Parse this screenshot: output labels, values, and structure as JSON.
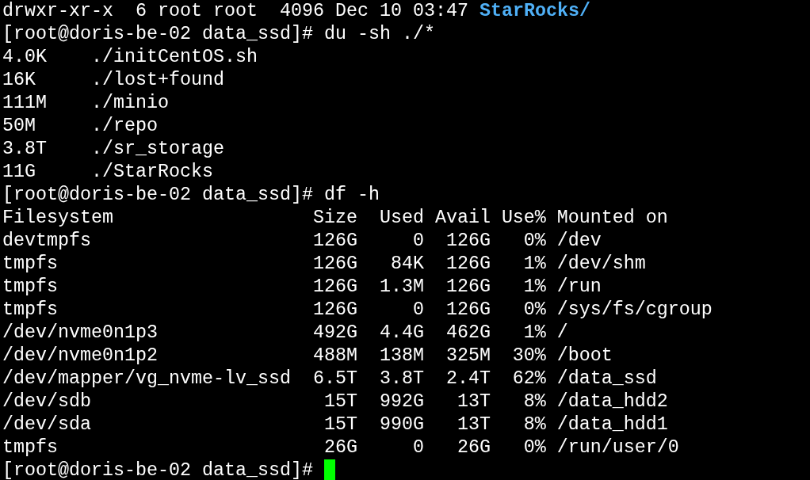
{
  "terminal": {
    "lines": [
      {
        "kind": "listing",
        "text": "drwxr-xr-x  6 root root  4096 Dec 10 03:47",
        "entry": "StarRocks/"
      },
      {
        "kind": "command",
        "prompt": "[root@doris-be-02 data_ssd]#",
        "command": "du -sh ./*",
        "cursor": false
      },
      {
        "kind": "du",
        "size": "4.0K",
        "path": "./initCentOS.sh"
      },
      {
        "kind": "du",
        "size": "16K",
        "path": "./lost+found"
      },
      {
        "kind": "du",
        "size": "111M",
        "path": "./minio"
      },
      {
        "kind": "du",
        "size": "50M",
        "path": "./repo"
      },
      {
        "kind": "du",
        "size": "3.8T",
        "path": "./sr_storage"
      },
      {
        "kind": "du",
        "size": "11G",
        "path": "./StarRocks"
      },
      {
        "kind": "command",
        "prompt": "[root@doris-be-02 data_ssd]#",
        "command": "df -h",
        "cursor": false
      },
      {
        "kind": "df",
        "cells": [
          "Filesystem",
          "Size",
          "Used",
          "Avail",
          "Use%",
          "Mounted on"
        ]
      },
      {
        "kind": "df",
        "cells": [
          "devtmpfs",
          "126G",
          "0",
          "126G",
          "0%",
          "/dev"
        ]
      },
      {
        "kind": "df",
        "cells": [
          "tmpfs",
          "126G",
          "84K",
          "126G",
          "1%",
          "/dev/shm"
        ]
      },
      {
        "kind": "df",
        "cells": [
          "tmpfs",
          "126G",
          "1.3M",
          "126G",
          "1%",
          "/run"
        ]
      },
      {
        "kind": "df",
        "cells": [
          "tmpfs",
          "126G",
          "0",
          "126G",
          "0%",
          "/sys/fs/cgroup"
        ]
      },
      {
        "kind": "df",
        "cells": [
          "/dev/nvme0n1p3",
          "492G",
          "4.4G",
          "462G",
          "1%",
          "/"
        ]
      },
      {
        "kind": "df",
        "cells": [
          "/dev/nvme0n1p2",
          "488M",
          "138M",
          "325M",
          "30%",
          "/boot"
        ]
      },
      {
        "kind": "df",
        "cells": [
          "/dev/mapper/vg_nvme-lv_ssd",
          "6.5T",
          "3.8T",
          "2.4T",
          "62%",
          "/data_ssd"
        ]
      },
      {
        "kind": "df",
        "cells": [
          "/dev/sdb",
          "15T",
          "992G",
          "13T",
          "8%",
          "/data_hdd2"
        ]
      },
      {
        "kind": "df",
        "cells": [
          "/dev/sda",
          "15T",
          "990G",
          "13T",
          "8%",
          "/data_hdd1"
        ]
      },
      {
        "kind": "df",
        "cells": [
          "tmpfs",
          "26G",
          "0",
          "26G",
          "0%",
          "/run/user/0"
        ]
      },
      {
        "kind": "command",
        "prompt": "[root@doris-be-02 data_ssd]#",
        "cursor": true
      }
    ]
  }
}
